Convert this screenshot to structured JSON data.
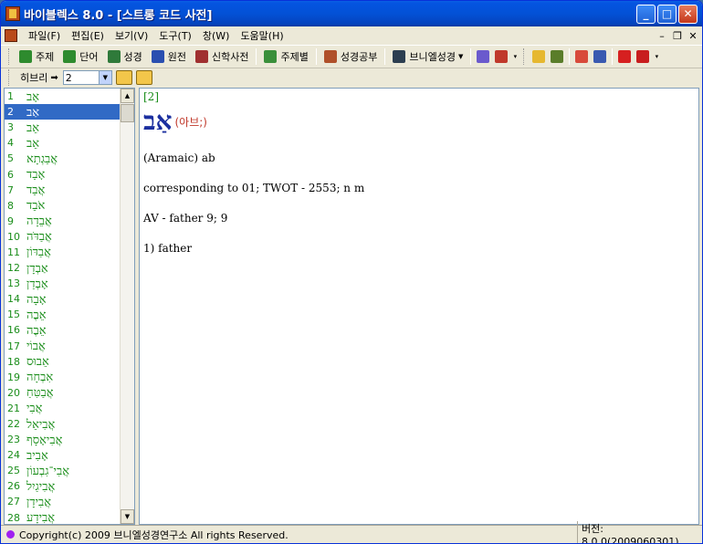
{
  "window": {
    "title": "바이블렉스 8.0 - [스트롱 코드 사전]"
  },
  "menu": [
    "파일(F)",
    "편집(E)",
    "보기(V)",
    "도구(T)",
    "창(W)",
    "도움말(H)"
  ],
  "toolbar": {
    "items": [
      {
        "label": "주제",
        "icon": "book-green-icon",
        "color": "#2e8b2e"
      },
      {
        "label": "단어",
        "icon": "book-green-icon",
        "color": "#2e8b2e"
      },
      {
        "label": "성경",
        "icon": "book-stack-icon",
        "color": "#2f7a3a"
      },
      {
        "label": "원전",
        "icon": "book-blue-icon",
        "color": "#2a4fb0"
      },
      {
        "label": "신학사전",
        "icon": "book-red-icon",
        "color": "#a03030"
      },
      {
        "label": "주제별",
        "icon": "tree-icon",
        "color": "#3a8f3a"
      },
      {
        "label": "성경공부",
        "icon": "study-icon",
        "color": "#b0502a"
      },
      {
        "label": "브니엘성경",
        "icon": "book-dark-icon",
        "color": "#2c3e50"
      }
    ]
  },
  "subbar": {
    "language_label": "히브리",
    "selected_number": "2"
  },
  "list": {
    "rows": [
      {
        "num": "1",
        "word": "אָב"
      },
      {
        "num": "2",
        "word": "אַב"
      },
      {
        "num": "3",
        "word": "אֵב"
      },
      {
        "num": "4",
        "word": "אֵב"
      },
      {
        "num": "5",
        "word": "אֲבַגְתָא"
      },
      {
        "num": "6",
        "word": "אָבַד"
      },
      {
        "num": "7",
        "word": "אֲבַד"
      },
      {
        "num": "8",
        "word": "אֹבֵד"
      },
      {
        "num": "9",
        "word": "אֲבֵדָה"
      },
      {
        "num": "10",
        "word": "אֲבַדֹּה"
      },
      {
        "num": "11",
        "word": "אֲבַדּוֹן"
      },
      {
        "num": "12",
        "word": "אַבְדָן"
      },
      {
        "num": "13",
        "word": "אָבְדַן"
      },
      {
        "num": "14",
        "word": "אָבָה"
      },
      {
        "num": "15",
        "word": "אֵבֶה"
      },
      {
        "num": "16",
        "word": "אֵבֶה"
      },
      {
        "num": "17",
        "word": "אֲבוֹי"
      },
      {
        "num": "18",
        "word": "אֵבוּס"
      },
      {
        "num": "19",
        "word": "אִבְחָה"
      },
      {
        "num": "20",
        "word": "אֲבַטִּחַ"
      },
      {
        "num": "21",
        "word": "אֲבִי"
      },
      {
        "num": "22",
        "word": "אֲבִיאֵל"
      },
      {
        "num": "23",
        "word": "אֲבִיאָסָף"
      },
      {
        "num": "24",
        "word": "אָבִיב"
      },
      {
        "num": "25",
        "word": "אֲבִי־גִבְעוֹן"
      },
      {
        "num": "26",
        "word": "אֲבִיגַיִל"
      },
      {
        "num": "27",
        "word": "אֲבִידָן"
      },
      {
        "num": "28",
        "word": "אֲבִידָע"
      }
    ],
    "selected_index": 1
  },
  "detail": {
    "ref": "[2]",
    "hebrew": "אַב",
    "pronunciation": "(아브;)",
    "origin": "(Aramaic) ab",
    "corresponding": "corresponding to 01; TWOT - 2553; n m",
    "av": "AV - father 9; 9",
    "definition": "1) father"
  },
  "status": {
    "copyright": "Copyright(c) 2009 브니엘성경연구소 All rights Reserved.",
    "version": "버전: 8,0,0(2009060301)"
  }
}
